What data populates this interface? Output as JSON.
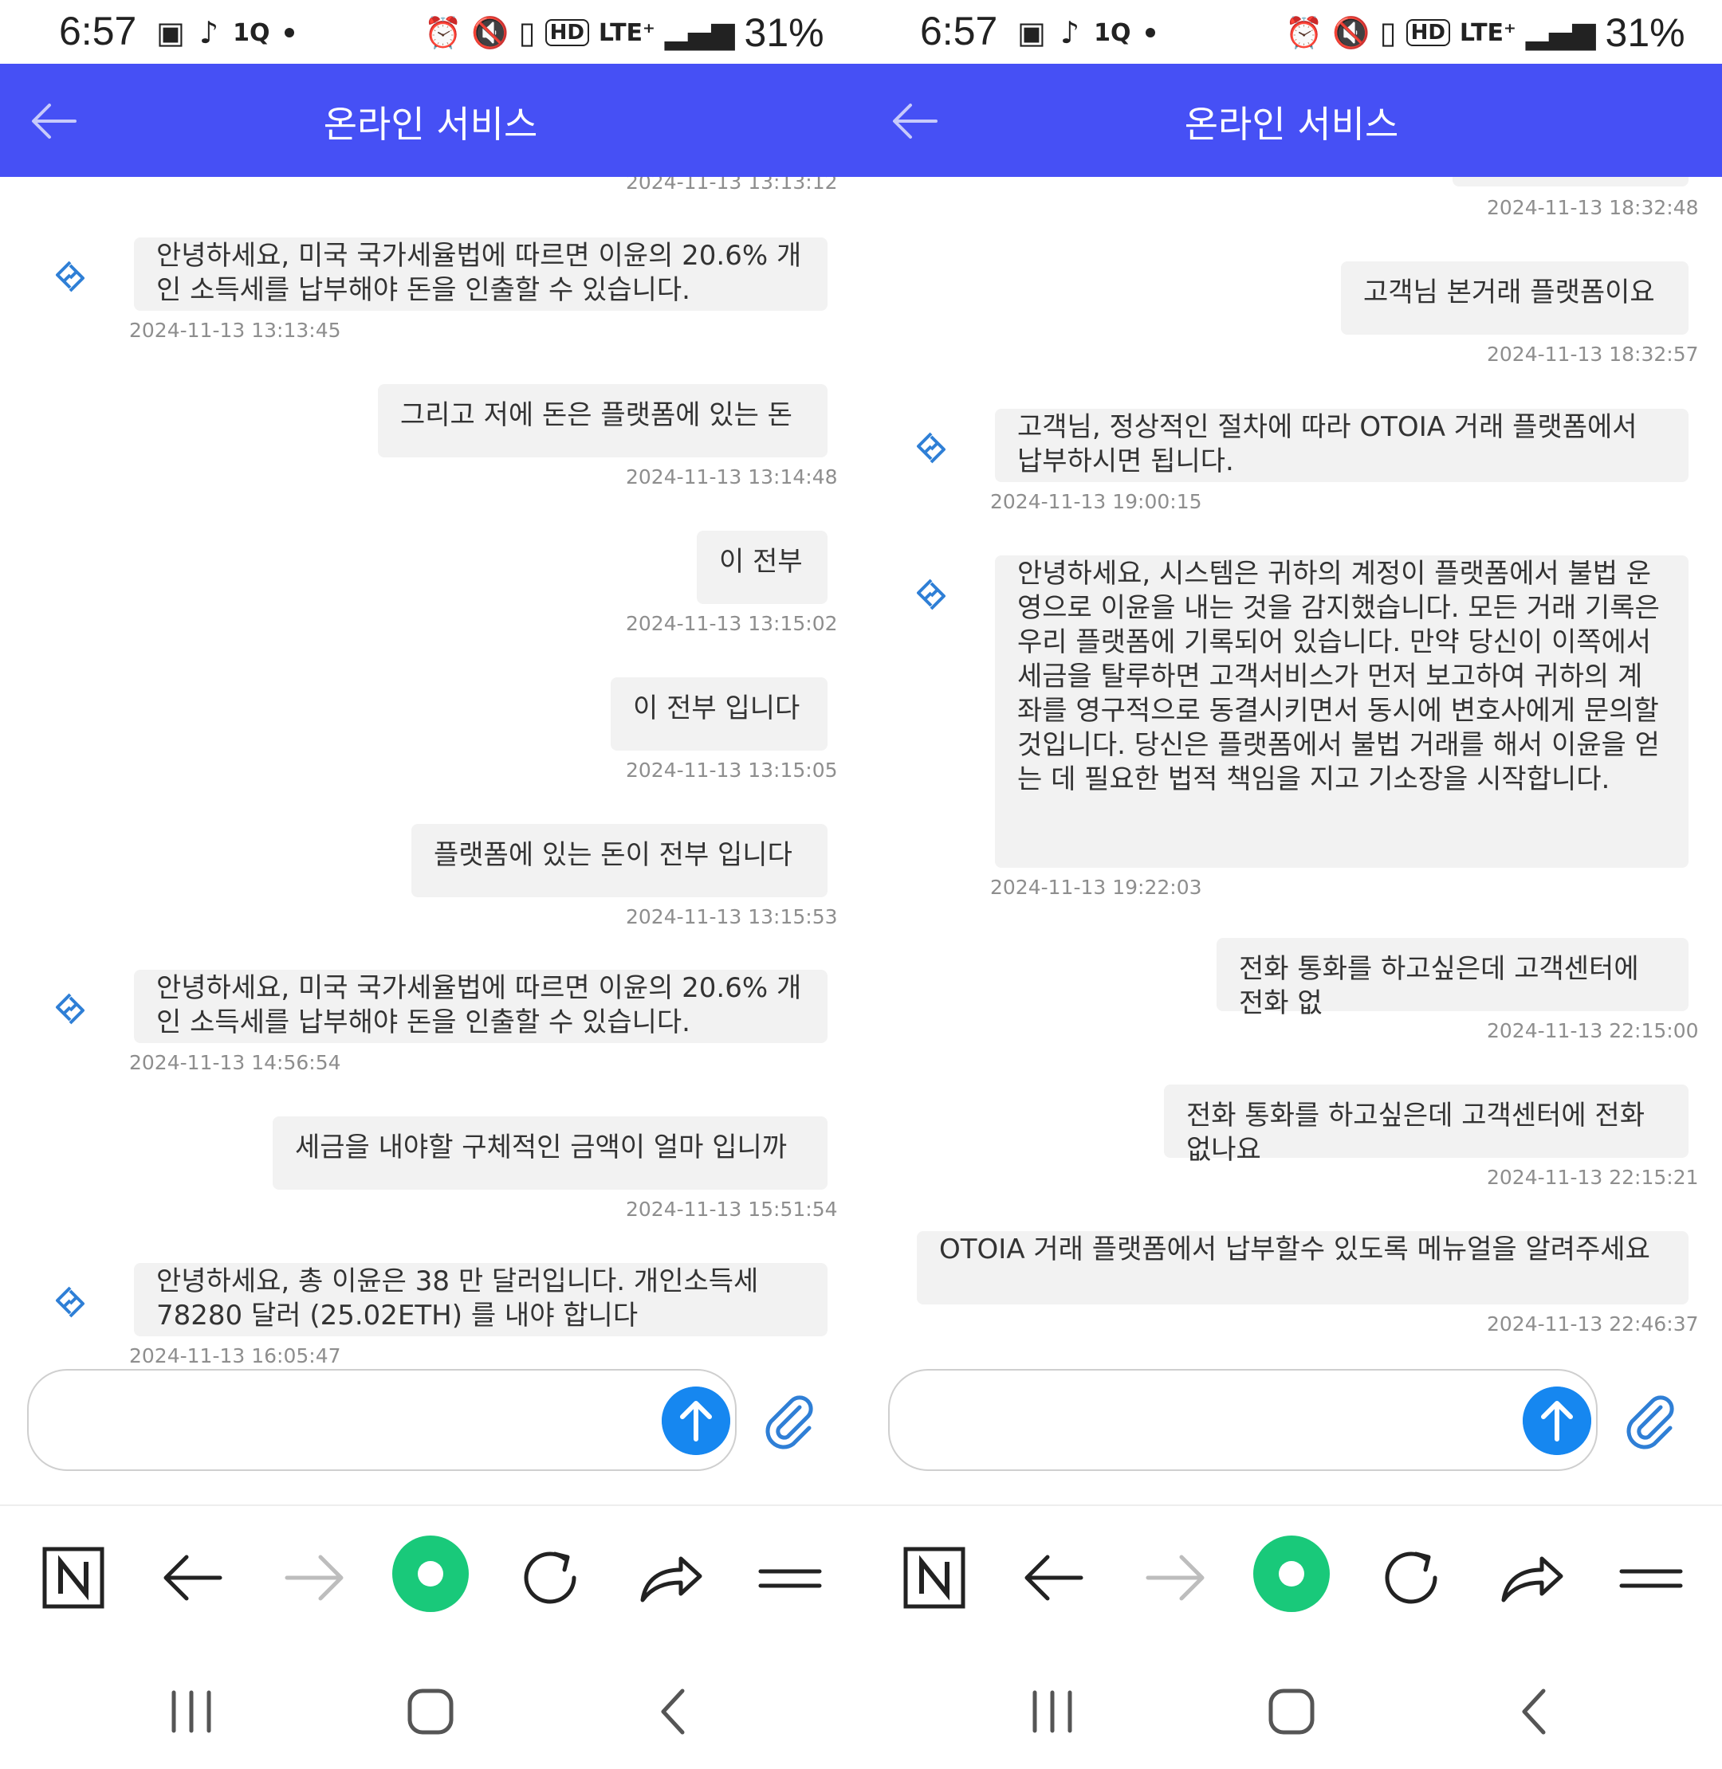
{
  "screens": [
    {
      "status": {
        "time": "6:57",
        "battery": "31%",
        "lte": "LTE⁺",
        "hd": "HD",
        "app_label": "1Q"
      },
      "header": {
        "title": "온라인 서비스"
      },
      "messages": [
        {
          "side": "right",
          "text": "",
          "time": "2024-11-13 13:13:12"
        },
        {
          "side": "left",
          "text": "안녕하세요, 미국 국가세율법에 따르면 이윤의 20.6% 개인 소득세를 납부해야 돈을 인출할 수 있습니다.",
          "time": "2024-11-13 13:13:45"
        },
        {
          "side": "right",
          "text": "그리고 저에 돈은 플랫폼에 있는 돈",
          "time": "2024-11-13 13:14:48"
        },
        {
          "side": "right",
          "text": "이 전부",
          "time": "2024-11-13 13:15:02"
        },
        {
          "side": "right",
          "text": "이 전부 입니다",
          "time": "2024-11-13 13:15:05"
        },
        {
          "side": "right",
          "text": "플랫폼에 있는 돈이 전부 입니다",
          "time": "2024-11-13 13:15:53"
        },
        {
          "side": "left",
          "text": "안녕하세요, 미국 국가세율법에 따르면 이윤의 20.6% 개인 소득세를 납부해야 돈을 인출할 수 있습니다.",
          "time": "2024-11-13 14:56:54"
        },
        {
          "side": "right",
          "text": "세금을 내야할 구체적인 금액이 얼마 입니까",
          "time": "2024-11-13 15:51:54"
        },
        {
          "side": "left",
          "text": "안녕하세요, 총 이윤은 38 만 달러입니다. 개인소득세 78280 달러 (25.02ETH) 를 내야 합니다",
          "time": "2024-11-13 16:05:47"
        }
      ]
    },
    {
      "status": {
        "time": "6:57",
        "battery": "31%",
        "lte": "LTE⁺",
        "hd": "HD",
        "app_label": "1Q"
      },
      "header": {
        "title": "온라인 서비스"
      },
      "messages": [
        {
          "side": "right",
          "text": "",
          "time": "2024-11-13 18:32:48"
        },
        {
          "side": "right",
          "text": "고객님 본거래 플랫폼이요",
          "time": "2024-11-13 18:32:57"
        },
        {
          "side": "left",
          "text": "고객님, 정상적인 절차에 따라 OTOIA 거래 플랫폼에서 납부하시면 됩니다.",
          "time": "2024-11-13 19:00:15"
        },
        {
          "side": "left",
          "text": "안녕하세요, 시스템은 귀하의 계정이 플랫폼에서 불법 운영으로 이윤을 내는 것을 감지했습니다. 모든 거래 기록은 우리 플랫폼에 기록되어 있습니다. 만약 당신이 이쪽에서 세금을 탈루하면 고객서비스가 먼저 보고하여 귀하의 계좌를 영구적으로 동결시키면서 동시에 변호사에게 문의할 것입니다. 당신은 플랫폼에서 불법 거래를 해서 이윤을 얻는 데 필요한 법적 책임을 지고 기소장을 시작합니다.",
          "time": "2024-11-13 19:22:03"
        },
        {
          "side": "right",
          "text": "전화 통화를 하고싶은데 고객센터에 전화 없",
          "time": "2024-11-13 22:15:00"
        },
        {
          "side": "right",
          "text": "전화 통화를 하고싶은데 고객센터에 전화 없나요",
          "time": "2024-11-13 22:15:21"
        },
        {
          "side": "right",
          "text": "OTOIA 거래 플랫폼에서 납부할수 있도록 메뉴얼을 알려주세요",
          "time": "2024-11-13 22:46:37"
        }
      ]
    }
  ],
  "input": {
    "placeholder": ""
  },
  "icons": {
    "back": "back-arrow-icon",
    "agent": "agent-logo-icon",
    "send": "send-up-arrow-icon",
    "attach": "paperclip-icon",
    "browser": [
      "naver-n-icon",
      "browser-back-icon",
      "browser-forward-icon",
      "home-circle-icon",
      "reload-icon",
      "share-icon",
      "menu-icon"
    ],
    "system_nav": [
      "recent-apps-icon",
      "home-icon",
      "system-back-icon"
    ]
  },
  "colors": {
    "header": "#4650f5",
    "send": "#1687f0",
    "agent_logo": "#2f7fd6",
    "home_green": "#19c97a"
  }
}
